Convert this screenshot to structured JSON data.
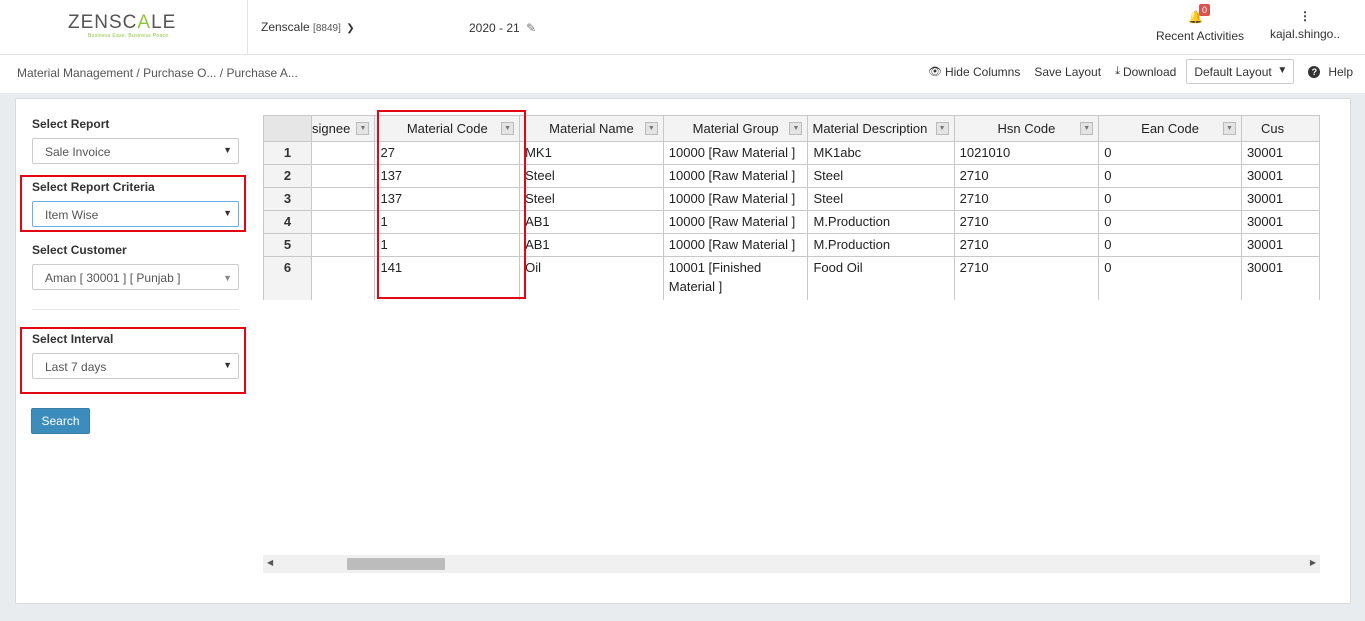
{
  "header": {
    "logo_main": "ZENSC",
    "logo_accent": "A",
    "logo_tail": "LE",
    "logo_tagline": "Business Ease. Business Peace.",
    "company_name": "Zenscale",
    "company_code": "[8849]",
    "fiscal_year": "2020 - 21",
    "notifications_count": "0",
    "recent_activities": "Recent Activities",
    "username": "kajal.shingo.."
  },
  "breadcrumb": {
    "items": [
      "Material Management",
      "/ Purchase O...",
      "/ Purchase A..."
    ]
  },
  "toolbar": {
    "hide_columns": "Hide Columns",
    "save_layout": "Save Layout",
    "download": "Download",
    "layout_value": "Default Layout",
    "help": "Help"
  },
  "filters": {
    "report_label": "Select Report",
    "report_value": "Sale Invoice",
    "criteria_label": "Select Report Criteria",
    "criteria_value": "Item Wise",
    "customer_label": "Select Customer",
    "customer_value": "Aman [ 30001 ] [ Punjab ]",
    "interval_label": "Select Interval",
    "interval_value": "Last 7 days",
    "search_label": "Search"
  },
  "grid": {
    "columns": [
      "signee",
      "Material Code",
      "Material Name",
      "Material Group",
      "Material Description",
      "Hsn Code",
      "Ean Code",
      "Cus"
    ],
    "rows": [
      {
        "n": "1",
        "cells": [
          "",
          "27",
          "MK1",
          "10000 [Raw Material ]",
          "MK1abc",
          "1021010",
          "0",
          "30001"
        ]
      },
      {
        "n": "2",
        "cells": [
          "",
          "137",
          "Steel",
          "10000 [Raw Material ]",
          "Steel",
          "2710",
          "0",
          "30001"
        ]
      },
      {
        "n": "3",
        "cells": [
          "",
          "137",
          "Steel",
          "10000 [Raw Material ]",
          "Steel",
          "2710",
          "0",
          "30001"
        ]
      },
      {
        "n": "4",
        "cells": [
          "",
          "1",
          "AB1",
          "10000 [Raw Material ]",
          "M.Production",
          "2710",
          "0",
          "30001"
        ]
      },
      {
        "n": "5",
        "cells": [
          "",
          "1",
          "AB1",
          "10000 [Raw Material ]",
          "M.Production",
          "2710",
          "0",
          "30001"
        ]
      },
      {
        "n": "6",
        "cells": [
          "",
          "141",
          "Oil",
          "10001 [Finished Material ]",
          "Food Oil",
          "2710",
          "0",
          "30001"
        ]
      }
    ]
  },
  "colors": {
    "highlight": "#e30613",
    "button": "#3c8dbc",
    "logo_accent": "#8cc63f",
    "badge": "#d9534f"
  }
}
